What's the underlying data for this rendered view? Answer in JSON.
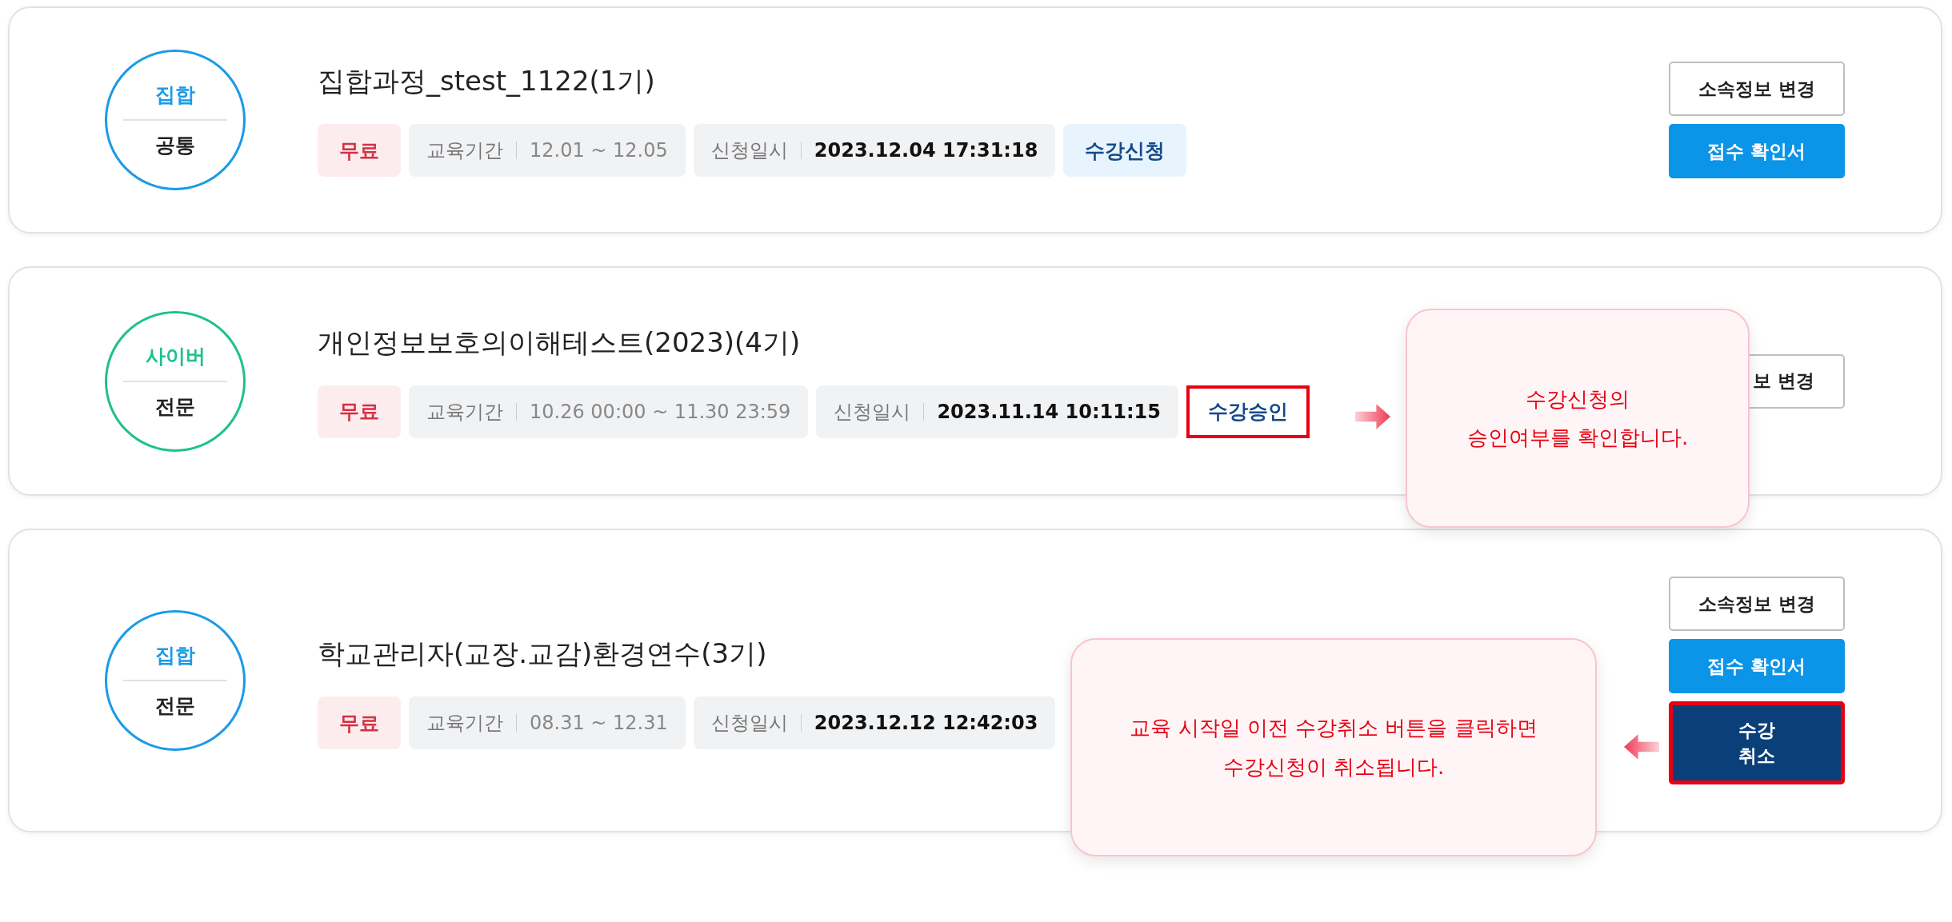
{
  "courses": [
    {
      "category": {
        "type": "집합",
        "level": "공통",
        "color": "#1a9be8"
      },
      "title": "집합과정_stest_1122(1기)",
      "tags": [
        {
          "kind": "price",
          "text": "무료"
        },
        {
          "kind": "period",
          "label": "교육기간",
          "value": "12.01 ~ 12.05"
        },
        {
          "kind": "date",
          "label": "신청일시",
          "value": "2023.12.04 17:31:18"
        },
        {
          "kind": "status",
          "text": "수강신청",
          "highlighted": false
        }
      ],
      "buttons": [
        {
          "kind": "outline",
          "label": "소속정보 변경",
          "highlighted": false
        },
        {
          "kind": "primary",
          "label": "접수 확인서",
          "highlighted": false
        }
      ]
    },
    {
      "category": {
        "type": "사이버",
        "level": "전문",
        "color": "#1fc08f"
      },
      "title": "개인정보보호의이해테스트(2023)(4기)",
      "tags": [
        {
          "kind": "price",
          "text": "무료"
        },
        {
          "kind": "period",
          "label": "교육기간",
          "value": "10.26 00:00 ~ 11.30 23:59"
        },
        {
          "kind": "date",
          "label": "신청일시",
          "value": "2023.11.14 10:11:15"
        },
        {
          "kind": "status",
          "text": "수강승인",
          "highlighted": true
        }
      ],
      "buttons": [
        {
          "kind": "outline",
          "label": "보 변경",
          "highlighted": false
        }
      ]
    },
    {
      "category": {
        "type": "집합",
        "level": "전문",
        "color": "#1a9be8"
      },
      "title": "학교관리자(교장.교감)환경연수(3기)",
      "tags": [
        {
          "kind": "price",
          "text": "무료"
        },
        {
          "kind": "period",
          "label": "교육기간",
          "value": "08.31 ~ 12.31"
        },
        {
          "kind": "date",
          "label": "신청일시",
          "value": "2023.12.12 12:42:03"
        }
      ],
      "buttons": [
        {
          "kind": "outline",
          "label": "소속정보 변경",
          "highlighted": false
        },
        {
          "kind": "primary",
          "label": "접수 확인서",
          "highlighted": false
        },
        {
          "kind": "dark",
          "label": "수강\n취소",
          "highlighted": true
        }
      ]
    }
  ],
  "callouts": [
    {
      "lines": [
        "수강신청의",
        "승인여부를 확인합니다."
      ],
      "kind": "right"
    },
    {
      "lines": [
        "교육 시작일 이전 수강취소 버튼을 클릭하면",
        "수강신청이 취소됩니다."
      ],
      "kind": "left"
    }
  ]
}
